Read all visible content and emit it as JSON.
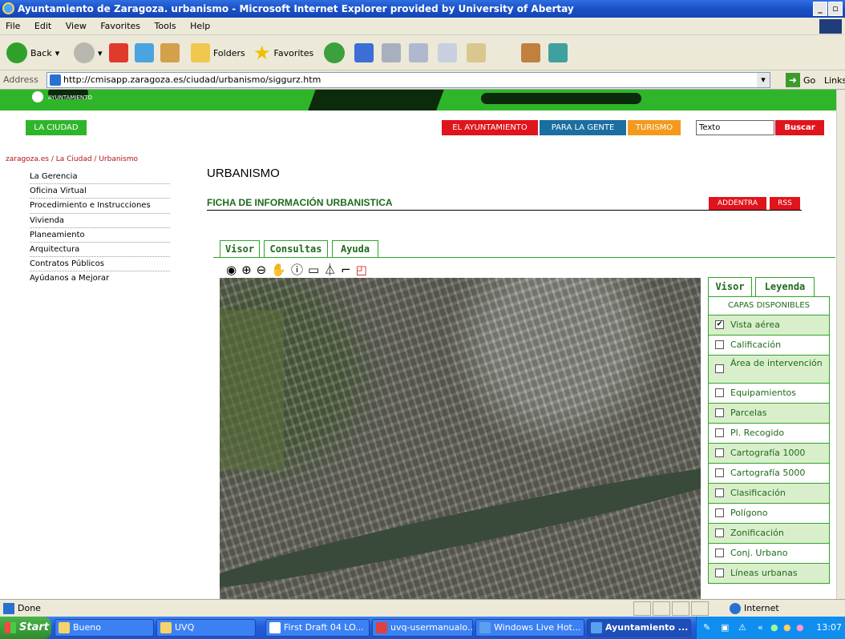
{
  "window": {
    "title": "Ayuntamiento de Zaragoza. urbanismo - Microsoft Internet Explorer provided by University of Abertay"
  },
  "menu": [
    "File",
    "Edit",
    "View",
    "Favorites",
    "Tools",
    "Help"
  ],
  "toolbar": {
    "back_label": "Back",
    "folders_label": "Folders",
    "favorites_label": "Favorites"
  },
  "address": {
    "label": "Address",
    "url": "http://cmisapp.zaragoza.es/ciudad/urbanismo/siggurz.htm",
    "go_label": "Go",
    "links_label": "Links"
  },
  "site": {
    "banner_ayto": "AYUNTAMIENTO",
    "la_ciudad": "LA CIUDAD",
    "nav": {
      "ayuntamiento": "EL AYUNTAMIENTO",
      "gente": "PARA LA GENTE",
      "turismo": "TURISMO"
    },
    "search_value": "Texto",
    "search_button": "Buscar",
    "breadcrumb": "zaragoza.es / La Ciudad / Urbanismo",
    "side_menu": [
      "La Gerencia",
      "Oficina Virtual",
      "Procedimiento e Instrucciones",
      "Vivienda",
      "Planeamiento",
      "Arquitectura",
      "Contratos Públicos",
      "Ayúdanos a Mejorar"
    ],
    "heading": "URBANISMO",
    "ficha": "FICHA DE INFORMACIÓN URBANISTICA",
    "addentra": "ADDENTRA",
    "rss": "RSS",
    "tabs": [
      "Visor",
      "Consultas",
      "Ayuda"
    ],
    "map_tools": [
      "pan-hand-icon",
      "zoom-out-icon",
      "zoom-in-icon",
      "hand-icon",
      "info-icon",
      "print-icon",
      "measure-icon",
      "scale-icon",
      "extent-icon"
    ],
    "panel_tabs": [
      "Visor",
      "Leyenda"
    ],
    "capas_title": "CAPAS DISPONIBLES",
    "layers": [
      {
        "label": "Vista aérea",
        "checked": true
      },
      {
        "label": "Calificación",
        "checked": false
      },
      {
        "label": "Área de intervención",
        "checked": false
      },
      {
        "label": "Equipamientos",
        "checked": false
      },
      {
        "label": "Parcelas",
        "checked": false
      },
      {
        "label": "Pl. Recogido",
        "checked": false
      },
      {
        "label": "Cartografía 1000",
        "checked": false
      },
      {
        "label": "Cartografía 5000",
        "checked": false
      },
      {
        "label": "Clasificación",
        "checked": false
      },
      {
        "label": "Polígono",
        "checked": false
      },
      {
        "label": "Zonificación",
        "checked": false
      },
      {
        "label": "Conj. Urbano",
        "checked": false
      },
      {
        "label": "Líneas urbanas",
        "checked": false
      }
    ]
  },
  "status": {
    "text": "Done",
    "zone": "Internet"
  },
  "taskbar": {
    "start": "Start",
    "tasks": [
      "Bueno",
      "UVQ",
      "First Draft 04 LO...",
      "uvq-usermanualo...",
      "Windows Live Hot...",
      "Ayuntamiento ..."
    ],
    "clock": "13:07"
  },
  "colors": {
    "green": "#2fb52a",
    "red": "#e0141c",
    "blue": "#1b6ea0",
    "orange": "#f39a1c"
  }
}
